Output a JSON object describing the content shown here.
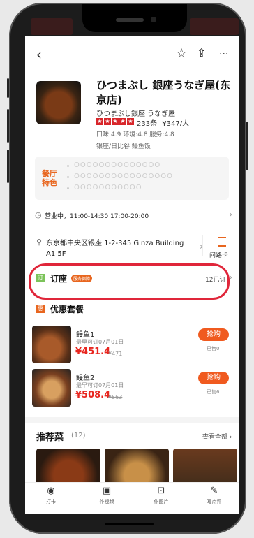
{
  "colors": {
    "accent": "#e8661f",
    "price": "#e8261f",
    "highlight": "#e0263a"
  },
  "nav": {
    "back_icon": "‹",
    "star_icon": "☆",
    "share_icon": "⇪",
    "more_icon": "···"
  },
  "restaurant": {
    "name": "ひつまぶし 銀座うなぎ屋(东京店)",
    "subname": "ひつまぶし銀座 うなぎ屋",
    "stars_text": "★★★★★",
    "reviews": "233条",
    "price_per": "¥347/人",
    "scores": "口味:4.9 环境:4.8 服务:4.8",
    "tags": "银座/日比谷  鳗鱼饭"
  },
  "specialty": {
    "logo_line1": "餐厅",
    "logo_line2": "特色",
    "lines": [
      "OOOOOOOOOOOOOO",
      "OOOOOOOOOOOOOOOO",
      "OOOOOOOOOOO"
    ]
  },
  "hours": {
    "text": "营业中，11:00-14:30 17:00-20:00"
  },
  "address": {
    "text": "东京都中央区银座 1-2-345 Ginza Building A1  5F",
    "directions_label": "问路卡"
  },
  "booking": {
    "label": "订座",
    "badge": "服务保障",
    "count": "12已订"
  },
  "deals": {
    "title": "优惠套餐",
    "items": [
      {
        "name": "鳗鱼1",
        "date": "最早可订07月01日",
        "price": "¥451.4",
        "original": "¥471",
        "buy": "抢购",
        "sold": "已售0"
      },
      {
        "name": "鳗鱼2",
        "date": "最早可订07月01日",
        "price": "¥508.4",
        "original": "¥563",
        "buy": "抢购",
        "sold": "已售6"
      }
    ]
  },
  "recommend": {
    "title": "推荐菜",
    "count": "(12)",
    "see_all": "查看全部 ›"
  },
  "tabbar": [
    {
      "icon": "◉",
      "label": "打卡"
    },
    {
      "icon": "▣",
      "label": "作视频"
    },
    {
      "icon": "⊡",
      "label": "作图片"
    },
    {
      "icon": "✎",
      "label": "写点评"
    }
  ]
}
